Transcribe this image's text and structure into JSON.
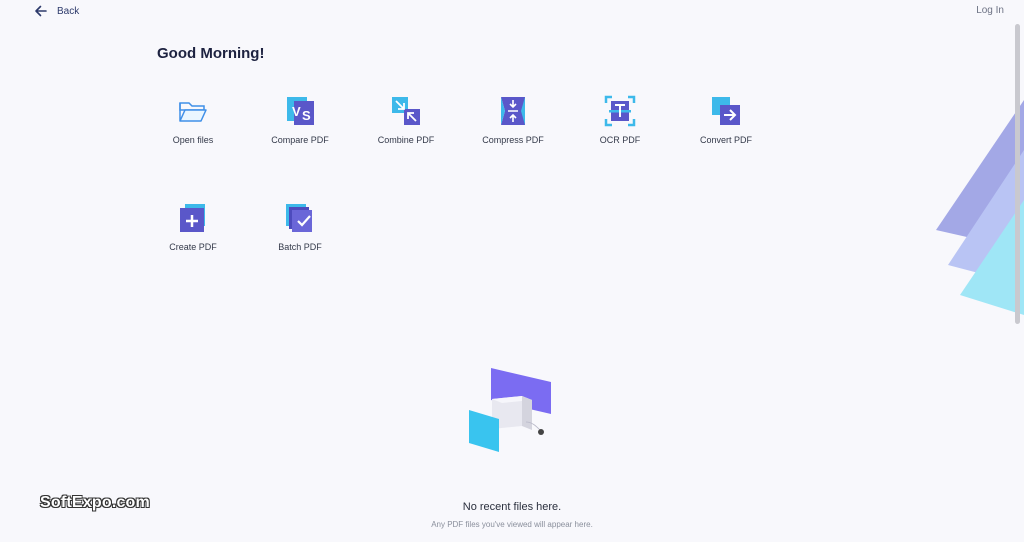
{
  "header": {
    "back_label": "Back",
    "login_label": "Log In"
  },
  "greeting": "Good Morning!",
  "tools": [
    {
      "label": "Open files"
    },
    {
      "label": "Compare PDF"
    },
    {
      "label": "Combine PDF"
    },
    {
      "label": "Compress PDF"
    },
    {
      "label": "OCR PDF"
    },
    {
      "label": "Convert PDF"
    },
    {
      "label": "Create PDF"
    },
    {
      "label": "Batch PDF"
    }
  ],
  "empty_state": {
    "title": "No recent files here.",
    "subtitle": "Any PDF files you've viewed will appear here."
  },
  "watermark": "SoftExpo.com",
  "colors": {
    "accent": "#5b5fc7",
    "cyan": "#39c4ef",
    "purple": "#7b6cf2"
  }
}
